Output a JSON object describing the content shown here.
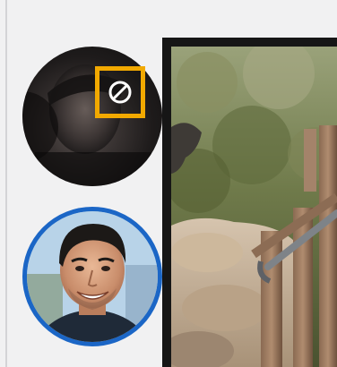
{
  "participants": [
    {
      "avatar_state": "camera-blocked",
      "badge_icon": "blocked-icon",
      "badge_color": "#f2a900"
    },
    {
      "avatar_state": "active",
      "ring_color": "#1b66c6"
    }
  ],
  "colors": {
    "background": "#f1f1f2",
    "active_ring": "#1b66c6",
    "blocked_badge": "#f2a900"
  }
}
